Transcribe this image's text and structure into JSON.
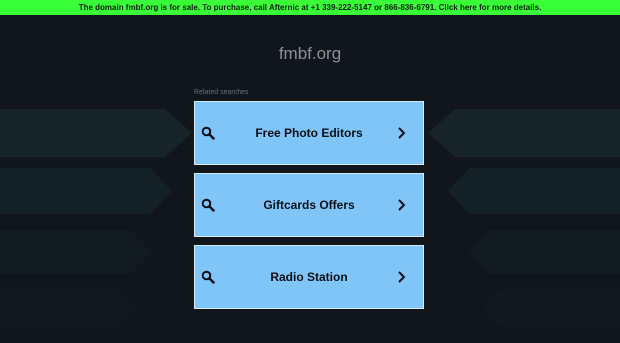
{
  "banner": {
    "text": "The domain fmbf.org is for sale. To purchase, call Afternic at +1 339-222-5147 or 866-836-6791. Click here for more details."
  },
  "page": {
    "domain": "fmbf.org",
    "related_label": "Related searches"
  },
  "searches": [
    {
      "label": "Free Photo Editors",
      "icon": "search-icon",
      "arrow": "chevron-right-icon"
    },
    {
      "label": "Giftcards Offers",
      "icon": "search-icon",
      "arrow": "chevron-right-icon"
    },
    {
      "label": "Radio Station",
      "icon": "search-icon",
      "arrow": "chevron-right-icon"
    }
  ],
  "colors": {
    "banner_bg": "#39ff39",
    "page_bg": "#10161a",
    "card_bg": "#7fc5f8",
    "card_text": "#0a0f14"
  }
}
